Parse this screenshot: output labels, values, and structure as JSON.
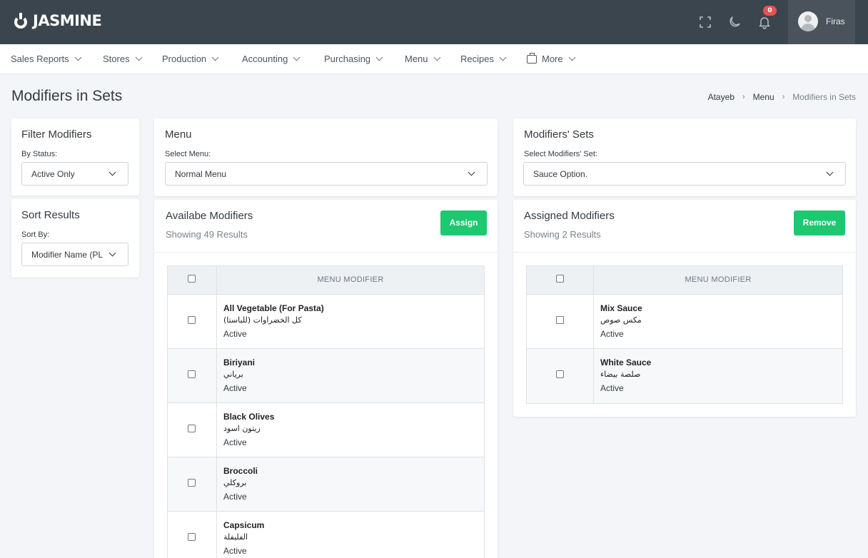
{
  "app": {
    "logo_text": "JASMINE"
  },
  "header": {
    "notification_count": "0",
    "user_name": "Firas"
  },
  "nav": [
    {
      "label": "Sales Reports"
    },
    {
      "label": "Stores"
    },
    {
      "label": "Production"
    },
    {
      "label": "Accounting"
    },
    {
      "label": "Purchasing"
    },
    {
      "label": "Menu"
    },
    {
      "label": "Recipes"
    },
    {
      "label": "More"
    }
  ],
  "page": {
    "title": "Modifiers in Sets"
  },
  "breadcrumb": [
    "Atayeb",
    "Menu",
    "Modifiers in Sets"
  ],
  "filter": {
    "title": "Filter Modifiers",
    "status_label": "By Status:",
    "status_value": "Active Only"
  },
  "sort": {
    "title": "Sort Results",
    "sort_label": "Sort By:",
    "sort_value": "Modifier Name (PL"
  },
  "menu": {
    "title": "Menu",
    "select_label": "Select Menu:",
    "select_value": "Normal Menu"
  },
  "sets": {
    "title": "Modifiers' Sets",
    "select_label": "Select Modifiers' Set:",
    "select_value": "Sauce Option."
  },
  "available": {
    "title": "Availabe Modifiers",
    "count_text": "Showing 49 Results",
    "button": "Assign",
    "column": "MENU MODIFIER",
    "rows": [
      {
        "name": "All Vegetable (For Pasta)",
        "arabic": "كل الخضراوات (للباستا)",
        "status": "Active"
      },
      {
        "name": "Biriyani",
        "arabic": "برياني",
        "status": "Active"
      },
      {
        "name": "Black Olives",
        "arabic": "زيتون اسود",
        "status": "Active"
      },
      {
        "name": "Broccoli",
        "arabic": "بروكلي",
        "status": "Active"
      },
      {
        "name": "Capsicum",
        "arabic": "الفليفلة",
        "status": "Active"
      }
    ]
  },
  "assigned": {
    "title": "Assigned Modifiers",
    "count_text": "Showing 2 Results",
    "button": "Remove",
    "column": "MENU MODIFIER",
    "rows": [
      {
        "name": "Mix Sauce",
        "arabic": "مكس صوص",
        "status": "Active"
      },
      {
        "name": "White Sauce",
        "arabic": "صلصة بيضاء",
        "status": "Active"
      }
    ]
  },
  "colors": {
    "topbar": "#3b454d",
    "accent_green": "#1dc870",
    "badge_red": "#e55353"
  }
}
